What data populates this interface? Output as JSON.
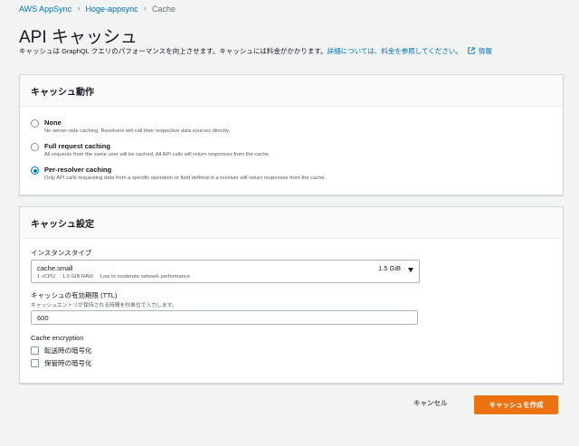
{
  "breadcrumb": {
    "items": [
      "AWS AppSync",
      "Hoge-appsync"
    ],
    "current": "Cache"
  },
  "page": {
    "title": "API キャッシュ",
    "description": "キャッシュは GraphQL クエリのパフォーマンスを向上させます。キャッシュには料金がかかります。",
    "description_link": "詳細については、料金を参照してください。",
    "info_link": "情報"
  },
  "behavior": {
    "header": "キャッシュ動作",
    "options": [
      {
        "label": "None",
        "description": "No server-side caching. Resolvers will call their respective data sources directly.",
        "selected": false
      },
      {
        "label": "Full request caching",
        "description": "All requests from the same user will be cached. All API calls will return responses from the cache.",
        "selected": false
      },
      {
        "label": "Per-resolver caching",
        "description": "Only API calls requesting data from a specific operation or field defined in a resolver will return responses from the cache.",
        "selected": true
      }
    ]
  },
  "settings": {
    "header": "キャッシュ設定",
    "instance_type": {
      "label": "インスタンスタイプ",
      "value": "cache.small",
      "vcpu": "1 vCPU",
      "ram": "1.5 GiB RAM",
      "performance": "Low to moderate network performance",
      "size": "1.5 GiB"
    },
    "ttl": {
      "label": "キャッシュの有効期限 (TTL)",
      "description": "キャッシュエントリが保持される時間を秒単位で入力します。",
      "value": "600"
    },
    "encryption": {
      "label": "Cache encryption",
      "in_transit": "転送時の暗号化",
      "at_rest": "保管時の暗号化"
    }
  },
  "actions": {
    "cancel": "キャンセル",
    "create": "キャッシュを作成"
  },
  "colors": {
    "primary": "#ec7211",
    "link": "#0073bb"
  }
}
